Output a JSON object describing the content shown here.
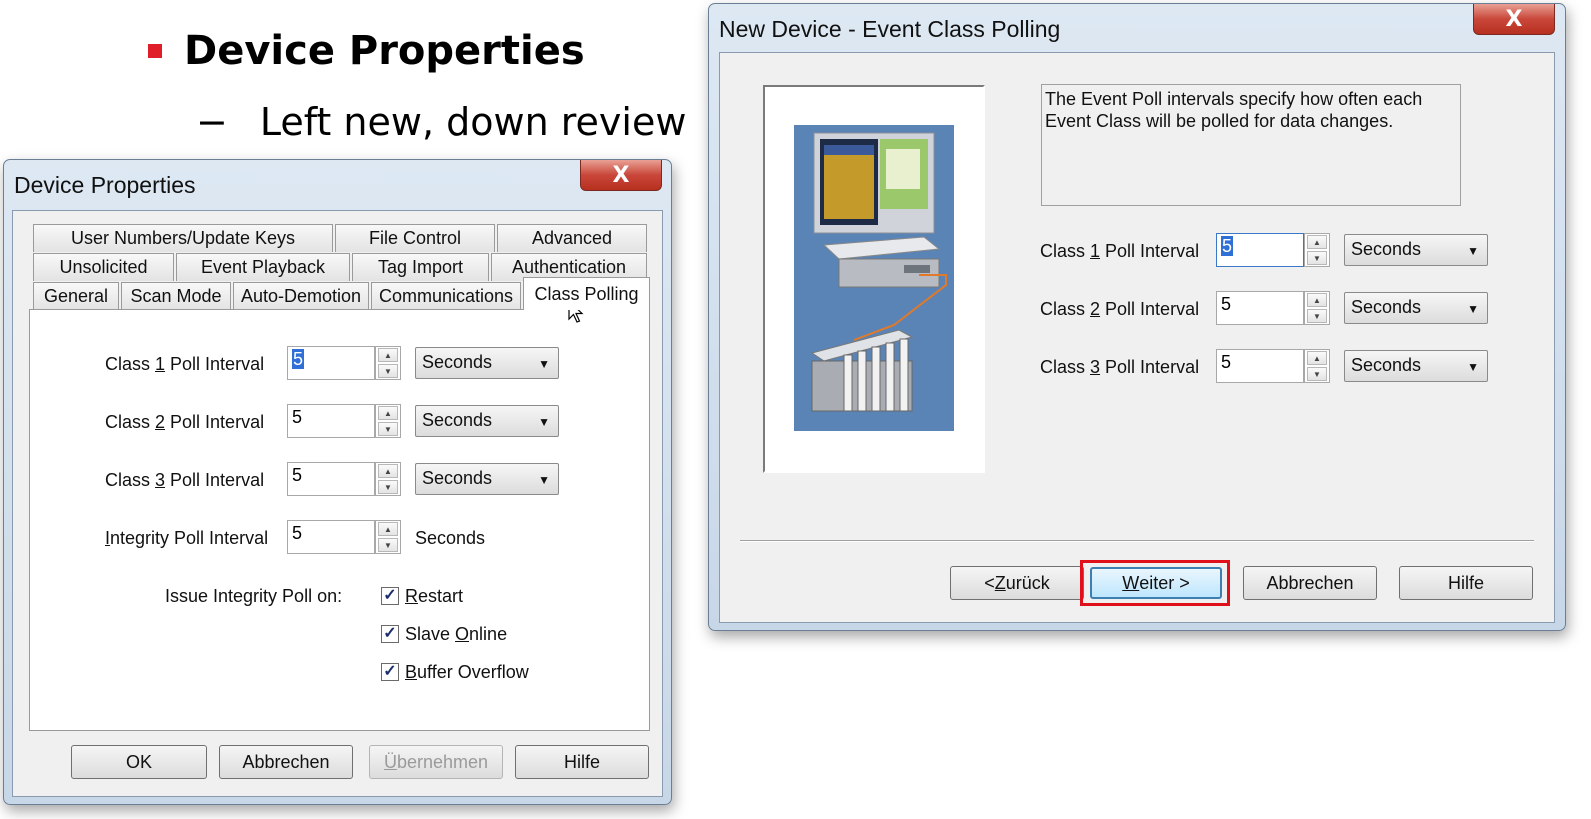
{
  "slide": {
    "title": "Device Properties",
    "subtitle_dash": "−",
    "subtitle": "Left new, down review",
    "bullet_color": "#e01e2a"
  },
  "device_properties": {
    "window_title": "Device Properties",
    "close_label": "X",
    "tabs_row1": [
      "User Numbers/Update Keys",
      "File Control",
      "Advanced"
    ],
    "tabs_row2": [
      "Unsolicited",
      "Event Playback",
      "Tag Import",
      "Authentication"
    ],
    "tabs_row3": [
      "General",
      "Scan Mode",
      "Auto-Demotion",
      "Communications",
      "Class Polling"
    ],
    "rows": [
      {
        "label_pre": "Class ",
        "label_key": "1",
        "label_post": " Poll Interval",
        "value": "5",
        "unit": "Seconds"
      },
      {
        "label_pre": "Class ",
        "label_key": "2",
        "label_post": " Poll Interval",
        "value": "5",
        "unit": "Seconds"
      },
      {
        "label_pre": "Class ",
        "label_key": "3",
        "label_post": " Poll Interval",
        "value": "5",
        "unit": "Seconds"
      },
      {
        "label_pre": "",
        "label_key": "I",
        "label_post": "ntegrity Poll Interval",
        "value": "5",
        "unit": "Seconds"
      }
    ],
    "issue_label": "Issue Integrity Poll on:",
    "checks": [
      {
        "key": "R",
        "rest": "estart",
        "checked": true
      },
      {
        "pre": "Slave ",
        "key": "O",
        "rest": "nline",
        "checked": true
      },
      {
        "key": "B",
        "rest": "uffer Overflow",
        "checked": true
      }
    ],
    "check_mark": "✓",
    "buttons": {
      "ok": "OK",
      "cancel": "Abbrechen",
      "apply_key": "Ü",
      "apply_rest": "bernehmen",
      "help": "Hilfe"
    }
  },
  "event_class_polling": {
    "window_title": "New Device - Event Class Polling",
    "close_label": "X",
    "description": "The Event Poll intervals specify how often each Event Class will be polled for data changes.",
    "rows": [
      {
        "label_pre": "Class ",
        "label_key": "1",
        "label_post": " Poll Interval",
        "value": "5",
        "unit": "Seconds"
      },
      {
        "label_pre": "Class ",
        "label_key": "2",
        "label_post": " Poll Interval",
        "value": "5",
        "unit": "Seconds"
      },
      {
        "label_pre": "Class ",
        "label_key": "3",
        "label_post": " Poll Interval",
        "value": "5",
        "unit": "Seconds"
      }
    ],
    "buttons": {
      "back_pre": "< ",
      "back_key": "Z",
      "back_rest": "urück",
      "next_key": "W",
      "next_rest": "eiter >",
      "cancel": "Abbrechen",
      "help": "Hilfe"
    },
    "highlight_color": "#e0101a"
  }
}
